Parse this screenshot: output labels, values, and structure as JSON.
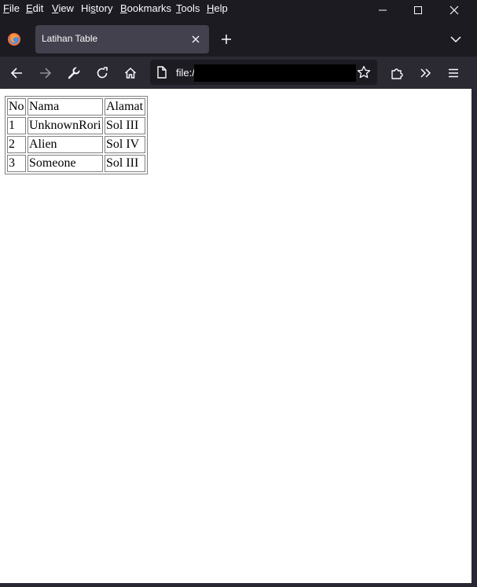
{
  "menubar": {
    "items": [
      {
        "accel": "F",
        "rest": "ile"
      },
      {
        "accel": "E",
        "rest": "dit"
      },
      {
        "accel": "V",
        "rest": "iew"
      },
      {
        "pre": "Hi",
        "accel": "s",
        "rest": "tory"
      },
      {
        "accel": "B",
        "rest": "ookmarks"
      },
      {
        "accel": "T",
        "rest": "ools"
      },
      {
        "accel": "H",
        "rest": "elp"
      }
    ]
  },
  "tab": {
    "title": "Latihan Table"
  },
  "urlbar": {
    "text": "file:/"
  },
  "table": {
    "headers": [
      "No",
      "Nama",
      "Alamat"
    ],
    "rows": [
      [
        "1",
        "UnknownRori",
        "Sol III"
      ],
      [
        "2",
        "Alien",
        "Sol IV"
      ],
      [
        "3",
        "Someone",
        "Sol III"
      ]
    ]
  },
  "colors": {
    "chrome_dark": "#1c1b22",
    "toolbar": "#2b2a33",
    "tab_active": "#42414d",
    "page": "#ffffff"
  }
}
